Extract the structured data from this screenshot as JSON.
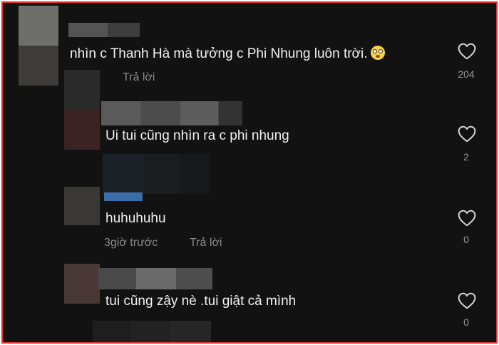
{
  "comments": [
    {
      "text": "nhìn c Thanh Hà mà tưởng c Phi Nhung luôn trời.",
      "emoji": "flushed-face-emoji",
      "reply_label": "Trả lời",
      "likes": "204"
    },
    {
      "text": "Ui tui cũng nhìn ra c phi nhung",
      "likes": "2"
    },
    {
      "text": "huhuhuhu",
      "time": "3giờ trước",
      "reply_label": "Trả lời",
      "likes": "0"
    },
    {
      "text": "tui cũng zậy nè .tui giật cả mình",
      "likes": "0"
    }
  ],
  "colors": {
    "background": "#121212",
    "border": "#e0322f",
    "text": "#f2f2f2",
    "muted": "#8a8a8a"
  },
  "icons": [
    "heart-icon"
  ]
}
